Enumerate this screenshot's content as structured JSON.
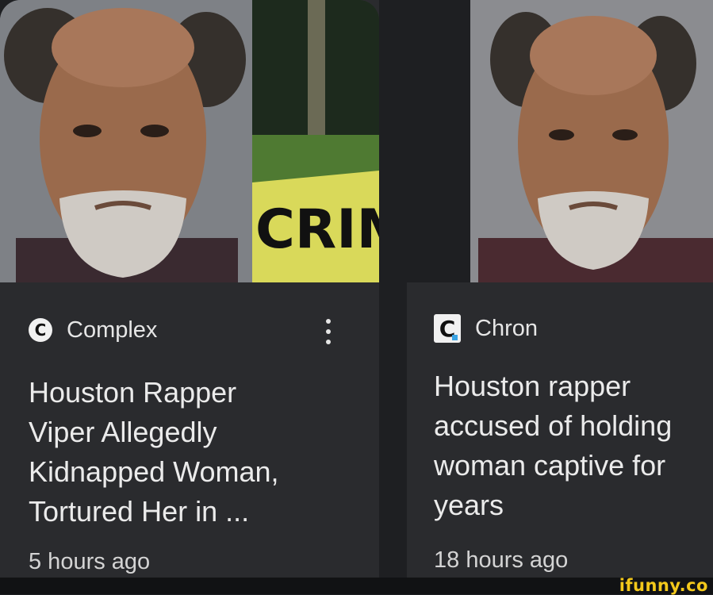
{
  "cards": [
    {
      "source": {
        "name": "Complex",
        "logo_letter": "C"
      },
      "headline": "Houston Rapper\nViper Allegedly\nKidnapped Woman,\nTortured Her in ...",
      "time": "5 hours ago",
      "image_caption_text": "CRIME"
    },
    {
      "source": {
        "name": "Chron",
        "logo_letter": "C"
      },
      "headline": "Houston rapper\naccused of holding\nwoman captive for\nyears",
      "time": "18 hours ago"
    }
  ],
  "watermark": "ifunny.co",
  "colors": {
    "background": "#1e1f22",
    "card": "#2a2b2e",
    "text": "#ebebeb",
    "watermark": "#f3c81b"
  }
}
